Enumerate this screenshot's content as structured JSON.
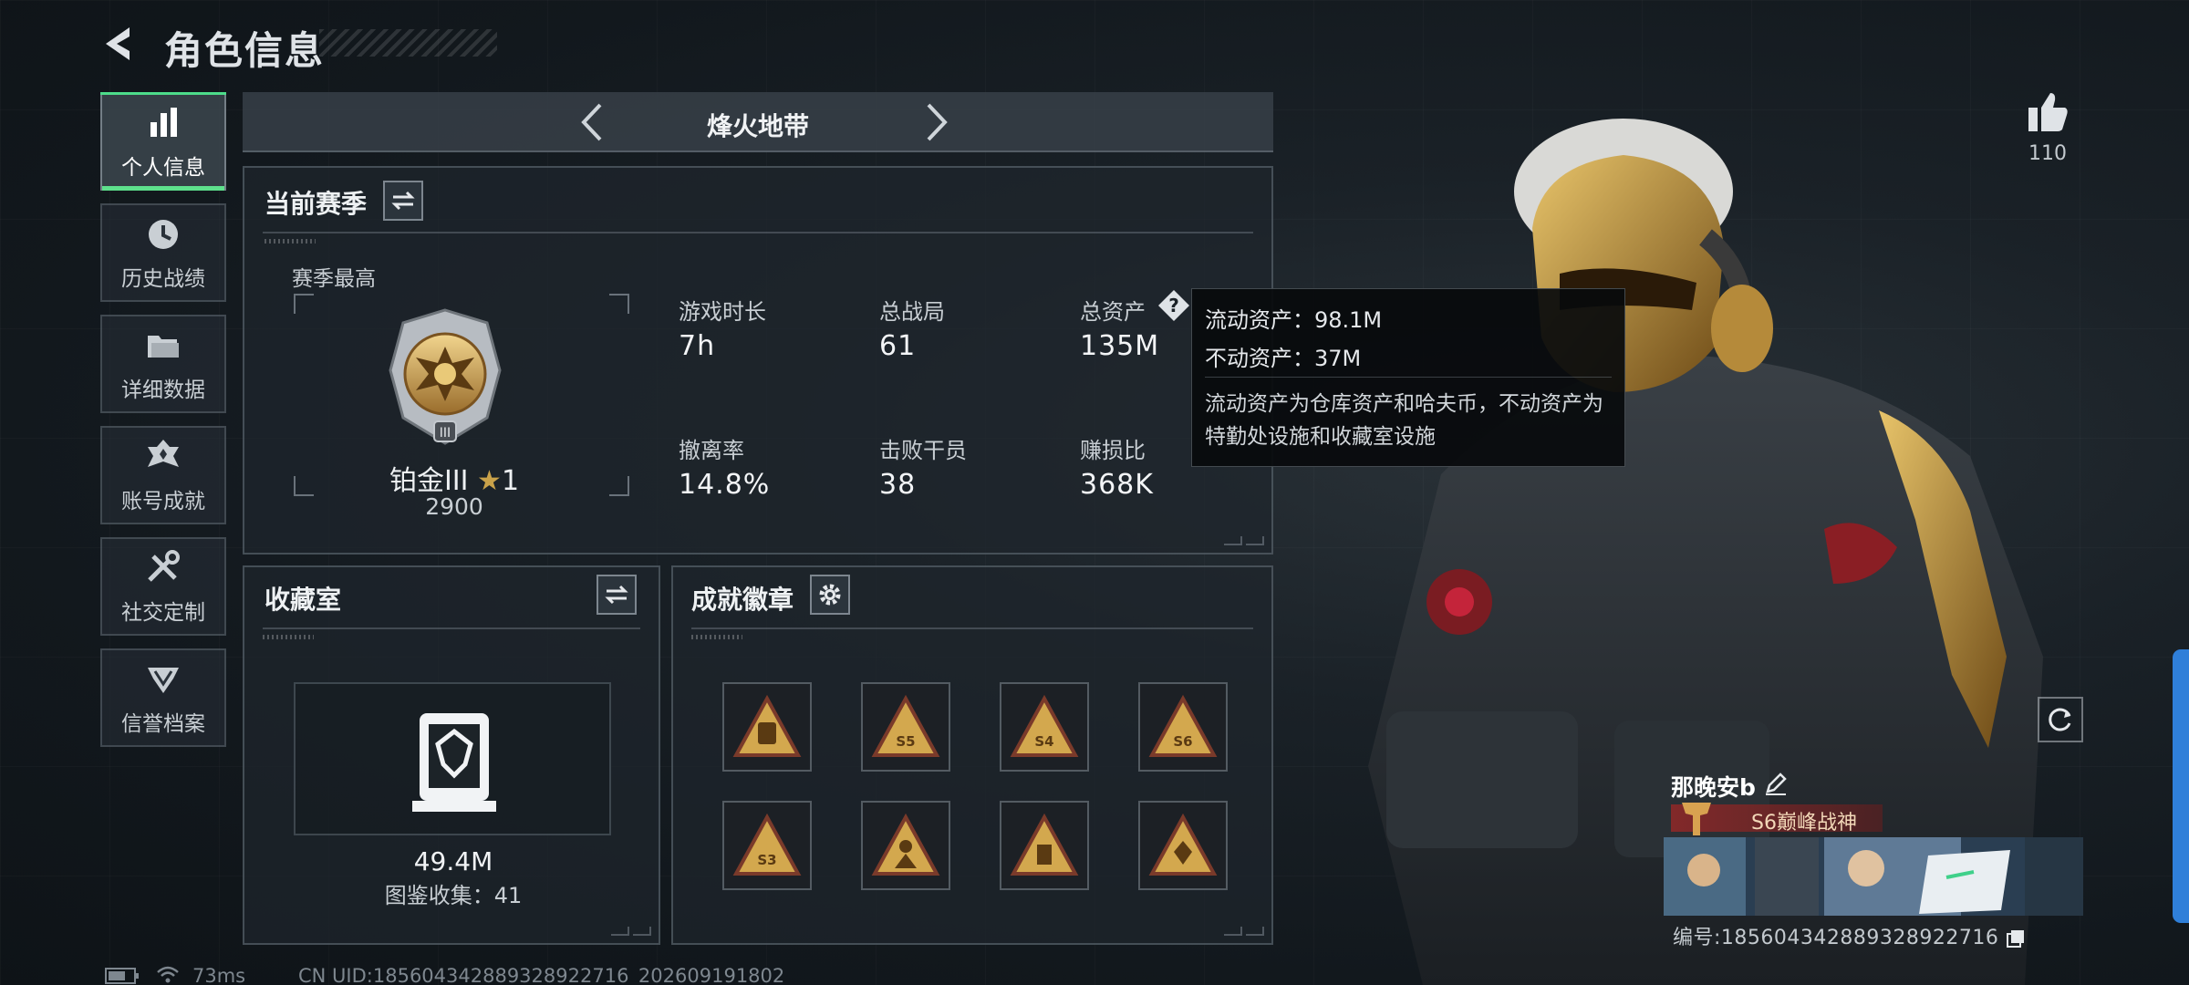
{
  "header": {
    "title": "角色信息"
  },
  "sidebar": {
    "items": [
      {
        "label": "个人信息",
        "icon": "bar-chart-icon",
        "active": true
      },
      {
        "label": "历史战绩",
        "icon": "history-clock-icon",
        "active": false
      },
      {
        "label": "详细数据",
        "icon": "folder-icon",
        "active": false
      },
      {
        "label": "账号成就",
        "icon": "achievement-icon",
        "active": false
      },
      {
        "label": "社交定制",
        "icon": "tools-icon",
        "active": false
      },
      {
        "label": "信誉档案",
        "icon": "credit-shield-icon",
        "active": false
      }
    ]
  },
  "mode": {
    "name": "烽火地带"
  },
  "season": {
    "title": "当前赛季",
    "best_label": "赛季最高",
    "rank_name": "铂金III",
    "rank_stars": "1",
    "rank_points": "2900",
    "stats": [
      {
        "label": "游戏时长",
        "value": "7h"
      },
      {
        "label": "总战局",
        "value": "61"
      },
      {
        "label": "总资产",
        "value": "135M"
      },
      {
        "label": "撤离率",
        "value": "14.8%"
      },
      {
        "label": "击败干员",
        "value": "38"
      },
      {
        "label": "赚损比",
        "value": "368K"
      }
    ]
  },
  "tooltip": {
    "liquid": "流动资产：98.1M",
    "fixed": "不动资产：37M",
    "desc": "流动资产为仓库资产和哈夫币，不动资产为特勤处设施和收藏室设施"
  },
  "collection": {
    "title": "收藏室",
    "value": "49.4M",
    "count_text": "图鉴收集：41"
  },
  "badges": {
    "title": "成就徽章",
    "items": [
      {
        "icon": "badge-backpack-icon",
        "text": ""
      },
      {
        "icon": "badge-s5-icon",
        "text": "S5"
      },
      {
        "icon": "badge-s4-icon",
        "text": "S4"
      },
      {
        "icon": "badge-s6-icon",
        "text": "S6"
      },
      {
        "icon": "badge-s3-icon",
        "text": "S3"
      },
      {
        "icon": "badge-operator-icon",
        "text": ""
      },
      {
        "icon": "badge-vault-icon",
        "text": ""
      },
      {
        "icon": "badge-diamond-icon",
        "text": ""
      }
    ]
  },
  "likes": {
    "count": "110"
  },
  "profile": {
    "name": "那晚安b",
    "rank_title": "S6巅峰战神",
    "id_text": "编号:185604342889328922716"
  },
  "status": {
    "ping": "73ms",
    "uid": "CN UID:185604342889328922716_202609191802"
  },
  "colors": {
    "accent_green": "#5ee08c",
    "gold": "#c9a24a",
    "rank_red": "#8c2828"
  }
}
